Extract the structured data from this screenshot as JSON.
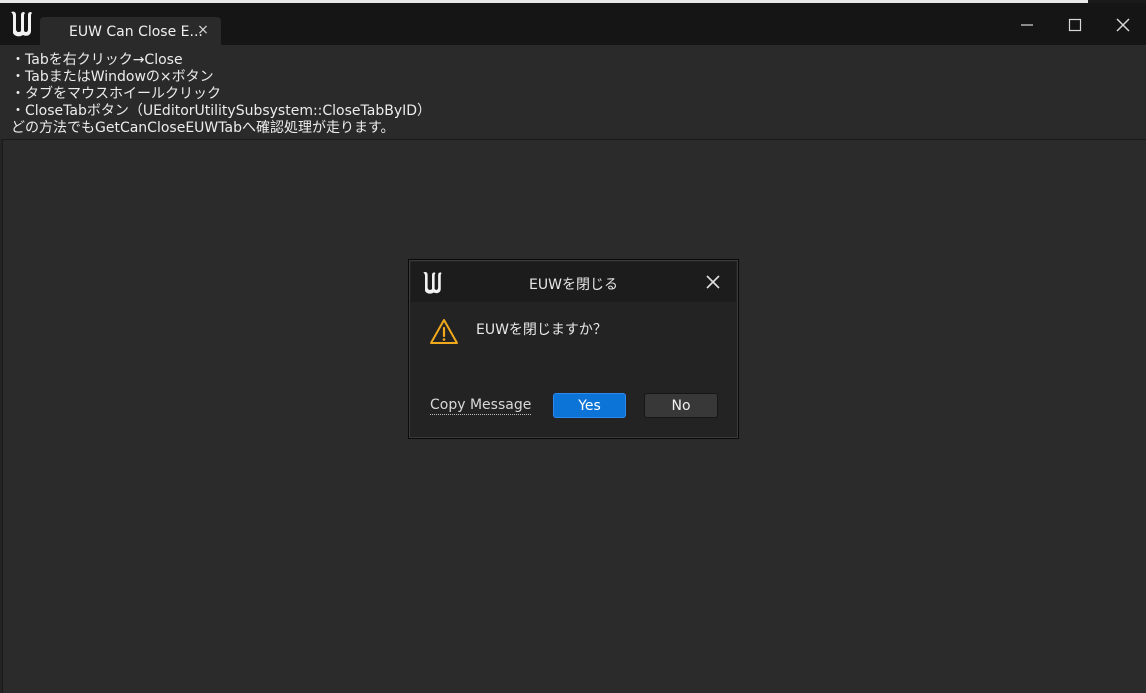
{
  "window": {
    "tab_title": "EUW Can Close E...",
    "tab_close_glyph": "×",
    "controls": {
      "minimize_icon": "minimize-icon",
      "maximize_icon": "maximize-icon",
      "close_icon": "close-icon"
    }
  },
  "info": {
    "lines": [
      "・Tabを右クリック→Close",
      "・TabまたはWindowの×ボタン",
      "・タブをマウスホイールクリック",
      "・CloseTabボタン（UEditorUtilitySubsystem::CloseTabByID）",
      "どの方法でもGetCanCloseEUWTabへ確認処理が走ります。"
    ]
  },
  "dialog": {
    "title": "EUWを閉じる",
    "message": "EUWを閉じますか？",
    "copy_label": "Copy Message",
    "yes_label": "Yes",
    "no_label": "No"
  },
  "colors": {
    "accent": "#0b74d6",
    "warning": "#f0a81c",
    "background": "#2b2b2b",
    "titlebar": "#151515"
  }
}
